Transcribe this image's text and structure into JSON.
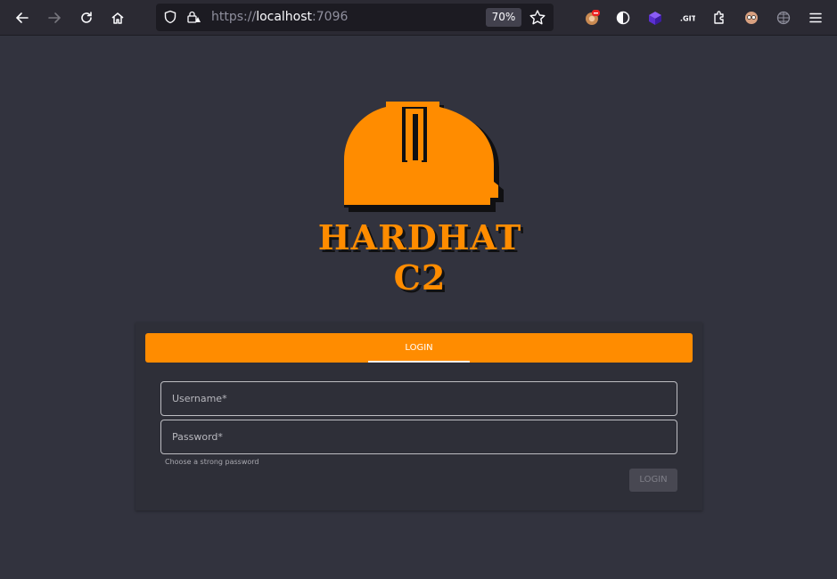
{
  "browser": {
    "url_scheme": "https://",
    "url_host": "localhost",
    "url_port": ":7096",
    "zoom": "70%"
  },
  "brand": {
    "name": "HARDHAT C2",
    "accent": "#ff8c00"
  },
  "login": {
    "tab_label": "LOGIN",
    "username_placeholder": "Username*",
    "password_placeholder": "Password*",
    "helper_text": "Choose a strong password",
    "submit_label": "LOGIN"
  },
  "icons": [
    "back-icon",
    "forward-icon",
    "reload-icon",
    "home-icon",
    "shield-icon",
    "lock-icon",
    "bookmark-star-icon",
    "extension-icons",
    "menu-icon"
  ]
}
